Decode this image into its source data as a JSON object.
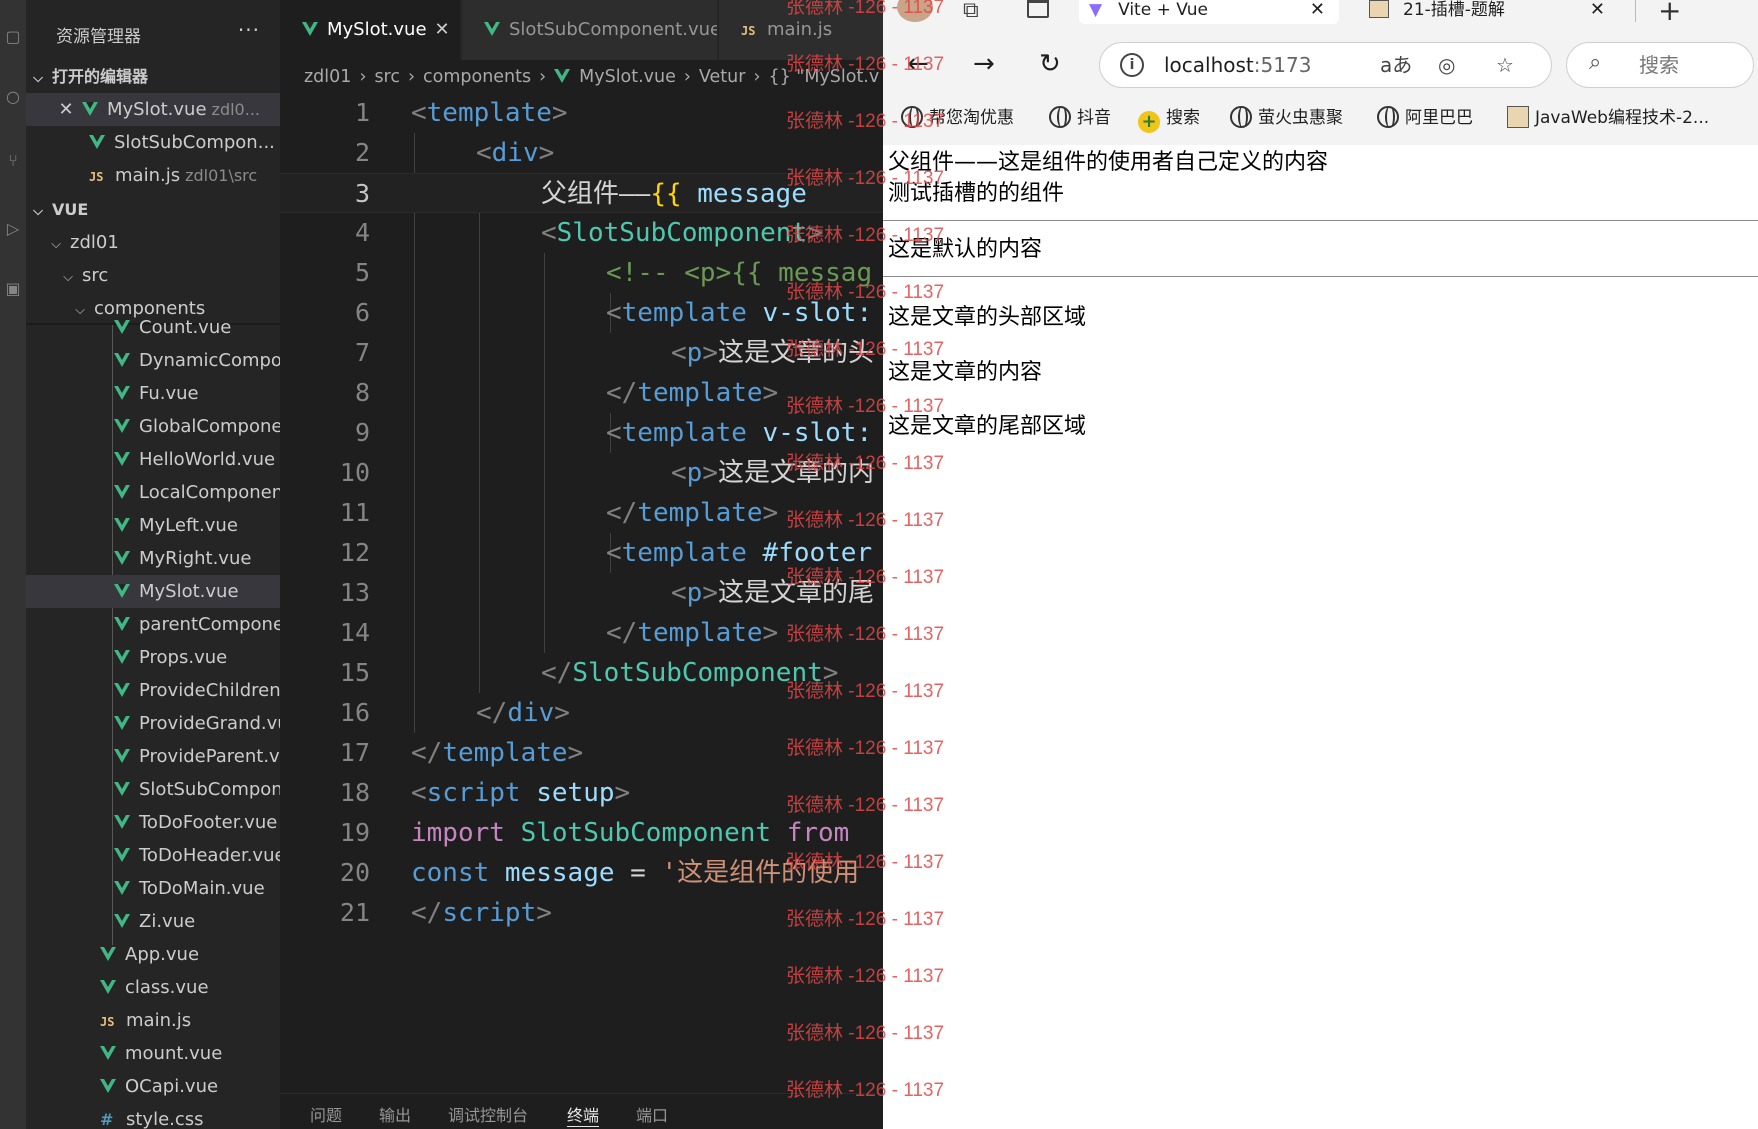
{
  "explorer": {
    "title": "资源管理器",
    "more": "···",
    "open_editors_label": "打开的编辑器",
    "open_editors": [
      {
        "name": "MySlot.vue",
        "sub": "zdl0...",
        "icon": "vue-icon"
      },
      {
        "name": "SlotSubCompon...",
        "sub": "",
        "icon": "vue-icon"
      },
      {
        "name": "main.js",
        "sub": "zdl01\\src",
        "icon": "js-icon"
      }
    ],
    "workspace_label": "VUE",
    "folders": [
      "zdl01",
      "src",
      "components"
    ],
    "component_files": [
      "Count.vue",
      "DynamicCompon...",
      "Fu.vue",
      "GlobalComponen...",
      "HelloWorld.vue",
      "LocalComponent....",
      "MyLeft.vue",
      "MyRight.vue",
      "MySlot.vue",
      "parentComponen...",
      "Props.vue",
      "ProvideChildren.v...",
      "ProvideGrand.vue",
      "ProvideParent.vue",
      "SlotSubCompone...",
      "ToDoFooter.vue",
      "ToDoHeader.vue",
      "ToDoMain.vue",
      "Zi.vue"
    ],
    "src_files": [
      {
        "name": "App.vue",
        "icon": "vue-icon"
      },
      {
        "name": "class.vue",
        "icon": "vue-icon"
      },
      {
        "name": "main.js",
        "icon": "js-icon"
      },
      {
        "name": "mount.vue",
        "icon": "vue-icon"
      },
      {
        "name": "OCapi.vue",
        "icon": "vue-icon"
      },
      {
        "name": "style.css",
        "icon": "css-icon"
      }
    ]
  },
  "editor": {
    "tabs": [
      {
        "label": "MySlot.vue",
        "active": true
      },
      {
        "label": "SlotSubComponent.vue",
        "active": false
      },
      {
        "label": "main.js",
        "active": false
      }
    ],
    "breadcrumb": [
      "zdl01",
      "src",
      "components",
      "MySlot.vue",
      "Vetur",
      "{} \"MySlot.v"
    ],
    "current_line": 3,
    "line_numbers": [
      "1",
      "2",
      "3",
      "4",
      "5",
      "6",
      "7",
      "8",
      "9",
      "10",
      "11",
      "12",
      "13",
      "14",
      "15",
      "16",
      "17",
      "18",
      "19",
      "20",
      "21"
    ],
    "code": {
      "l1_tag": "template",
      "l2_tag": "div",
      "l3_text": "父组件——",
      "l3_open": "{{",
      "l3_var": " message",
      "l4_comp": "SlotSubComponent",
      "l5_comment": "<!-- <p>{{ messag",
      "l6_tag": "template",
      "l6_attr": " v-slot:",
      "l7_tag": "p",
      "l7_text": "这是文章的头",
      "l8_tag": "template",
      "l9_tag": "template",
      "l9_attr": " v-slot:",
      "l10_tag": "p",
      "l10_text": "这是文章的内",
      "l11_tag": "template",
      "l12_tag": "template",
      "l12_attr": " #footer",
      "l13_tag": "p",
      "l13_text": "这是文章的尾",
      "l14_tag": "template",
      "l15_comp": "SlotSubComponent",
      "l16_tag": "div",
      "l17_tag": "template",
      "l18_tag": "script",
      "l18_attr": " setup",
      "l19_kw": "import",
      "l19_name": " SlotSubComponent ",
      "l19_from": "from",
      "l20_kw": "const",
      "l20_var": " message",
      "l20_eq": " = ",
      "l20_str": "'这是组件的使用",
      "l21_tag": "script"
    },
    "panel_tabs": [
      "问题",
      "输出",
      "调试控制台",
      "终端",
      "端口"
    ],
    "panel_active": "终端"
  },
  "browser": {
    "tabs": [
      {
        "label": "Vite + Vue",
        "active": true
      },
      {
        "label": "21-插槽-题解",
        "active": false
      }
    ],
    "new_tab": "+",
    "url_host": "localhost",
    "url_port": ":5173",
    "search_placeholder": "搜索",
    "bookmarks": [
      "帮您淘优惠",
      "抖音",
      "搜索",
      "萤火虫惠聚",
      "阿里巴巴",
      "JavaWeb编程技术-2..."
    ],
    "page": {
      "line1": "父组件——这是组件的使用者自己定义的内容",
      "line2": "测试插槽的的组件",
      "line3": "这是默认的内容",
      "line4": "这是文章的头部区域",
      "line5": "这是文章的内容",
      "line6": "这是文章的尾部区域"
    }
  },
  "watermark": "张德林 -126 - 1137"
}
